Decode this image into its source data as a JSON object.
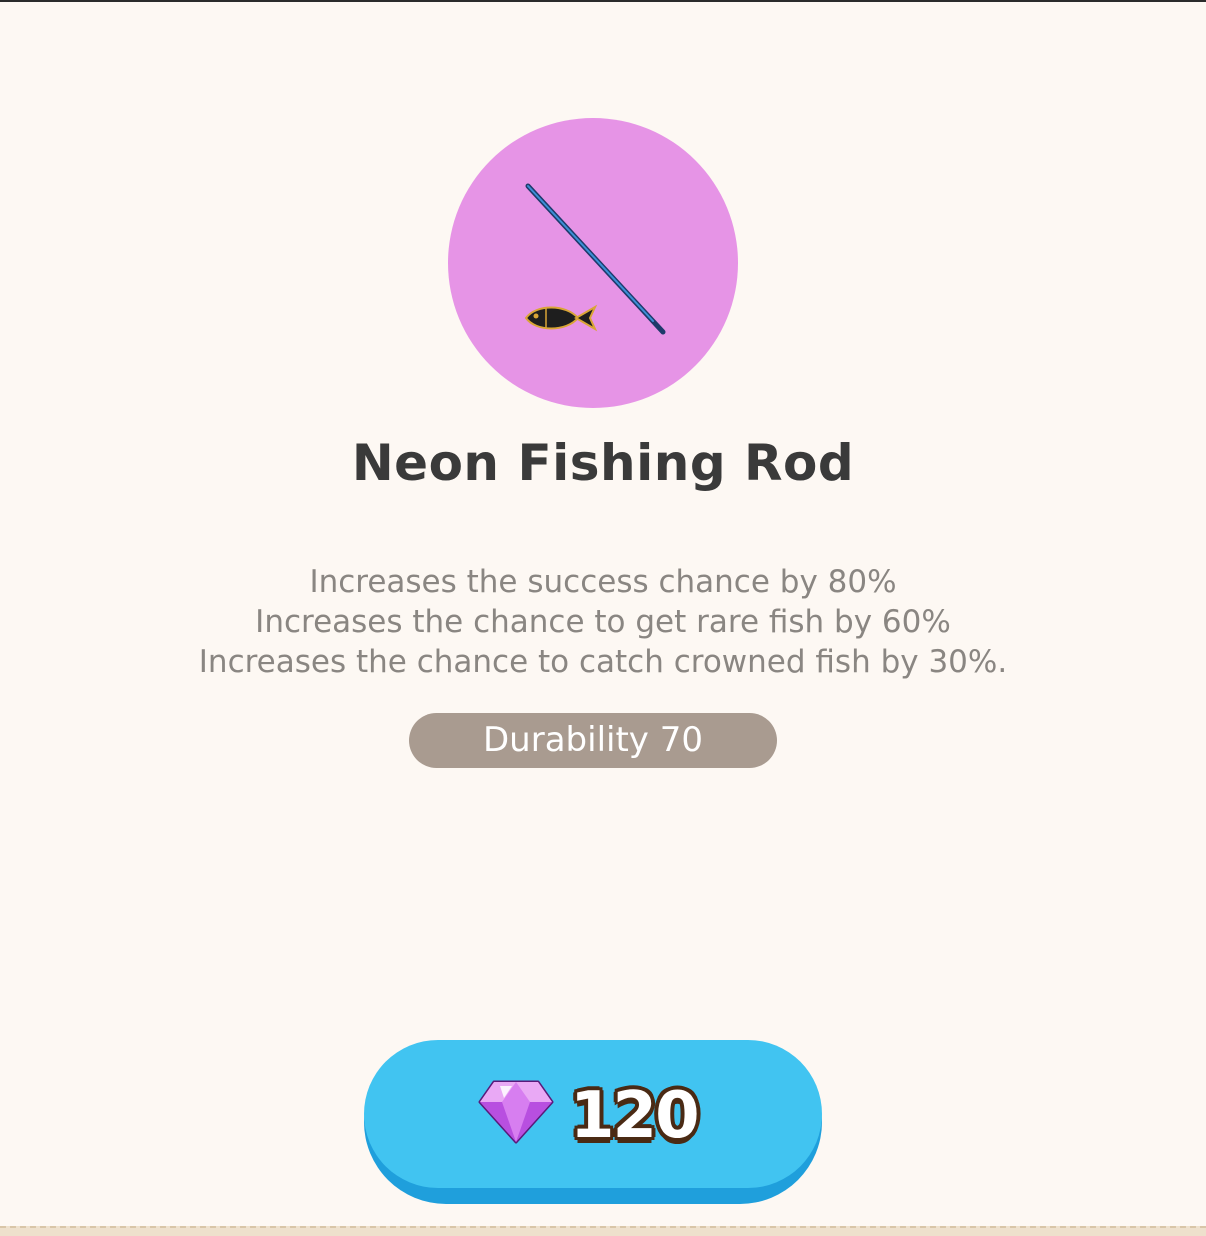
{
  "item": {
    "name": "Neon Fishing Rod",
    "icon": "neon-fishing-rod-icon",
    "icon_background": "#e694e6",
    "effects": [
      "Increases the success chance by 80%",
      "Increases the chance to get rare fish by 60%",
      "Increases the chance to catch crowned fish by 30%."
    ],
    "durability_label": "Durability 70"
  },
  "purchase": {
    "price": "120",
    "currency_icon": "gem-icon",
    "button_color": "#41c4f1"
  }
}
